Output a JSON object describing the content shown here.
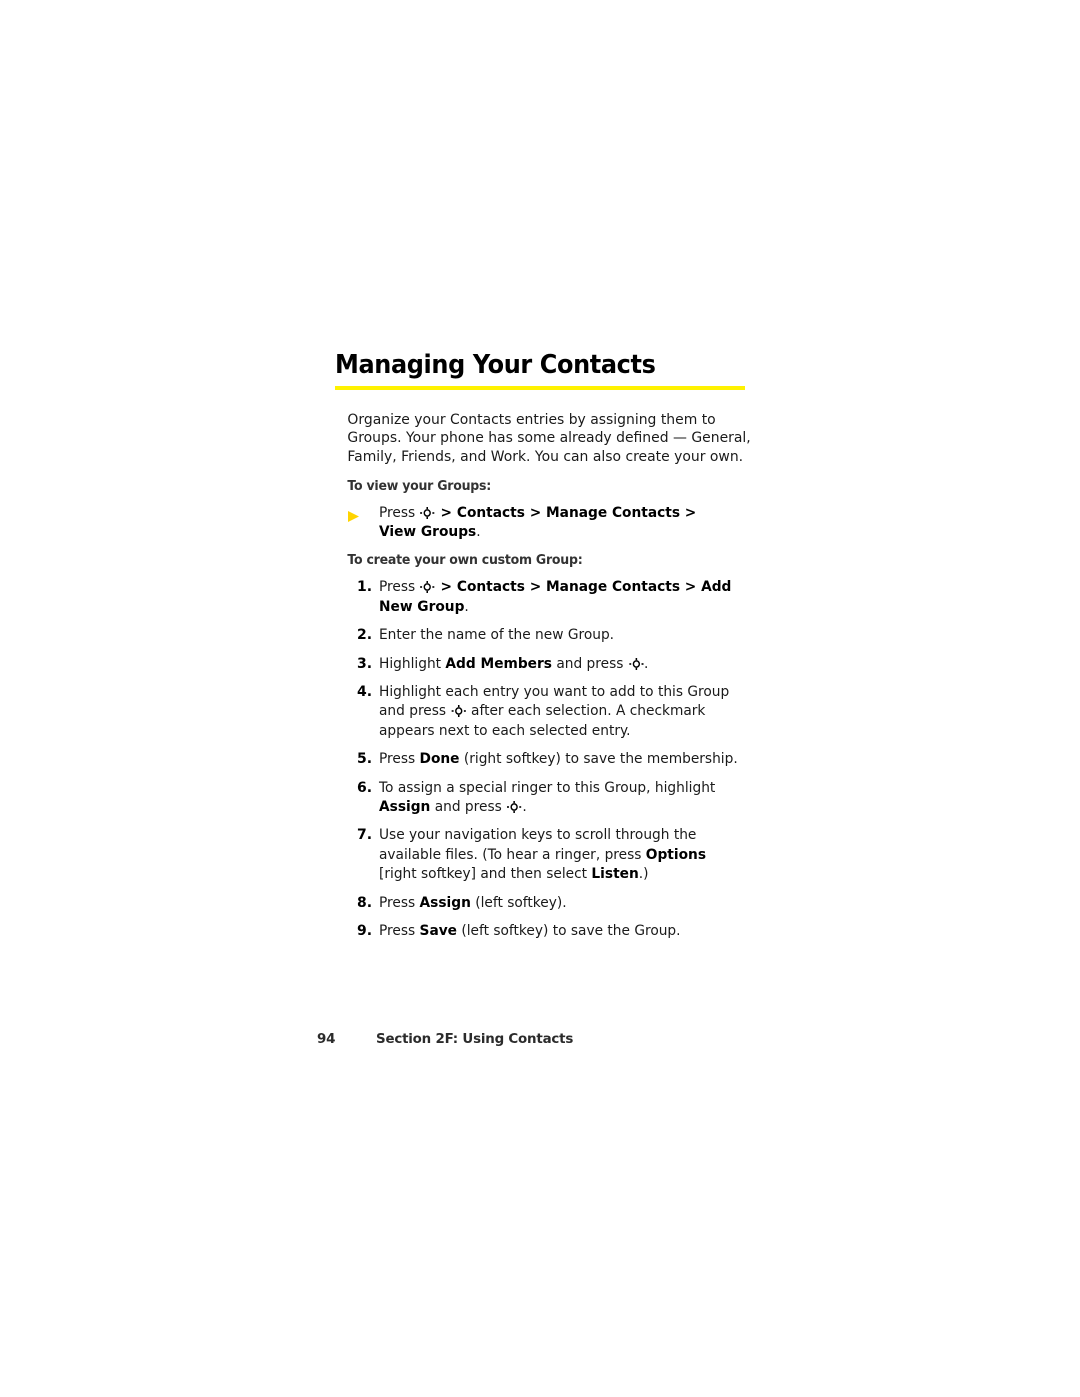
{
  "document": {
    "title": "Managing Your Contacts",
    "accent_color": "#fff200",
    "bullet_color": "#ffd400",
    "intro": "Organize your Contacts entries by assigning them to Groups. Your phone has some already defined — General, Family, Friends, and Work. You can also create your own.",
    "icons": {
      "nav_key": "navigation-key-icon",
      "bullet": "triangle-bullet-icon"
    },
    "sections": [
      {
        "heading": "To view your Groups:",
        "bullet_item": {
          "prefix": "Press ",
          "suffix_bold": " > Contacts > Manage Contacts > View Groups",
          "end": "."
        }
      },
      {
        "heading": "To create your own custom Group:"
      }
    ],
    "steps": [
      {
        "num": "1.",
        "parts": [
          {
            "t": "Press ",
            "b": false
          },
          {
            "t": "__NAVKEY__",
            "b": false
          },
          {
            "t": " > Contacts > Manage Contacts > Add New Group",
            "b": true
          },
          {
            "t": ".",
            "b": false
          }
        ]
      },
      {
        "num": "2.",
        "parts": [
          {
            "t": "Enter the name of the new Group.",
            "b": false
          }
        ]
      },
      {
        "num": "3.",
        "parts": [
          {
            "t": "Highlight ",
            "b": false
          },
          {
            "t": "Add Members",
            "b": true
          },
          {
            "t": " and press ",
            "b": false
          },
          {
            "t": "__NAVKEY__",
            "b": false
          },
          {
            "t": ".",
            "b": false
          }
        ]
      },
      {
        "num": "4.",
        "parts": [
          {
            "t": "Highlight each entry you want to add to this Group and press ",
            "b": false
          },
          {
            "t": "__NAVKEY__",
            "b": false
          },
          {
            "t": " after each selection. A checkmark appears next to each selected entry.",
            "b": false
          }
        ]
      },
      {
        "num": "5.",
        "parts": [
          {
            "t": "Press ",
            "b": false
          },
          {
            "t": "Done",
            "b": true
          },
          {
            "t": " (right softkey) to save the membership.",
            "b": false
          }
        ]
      },
      {
        "num": "6.",
        "parts": [
          {
            "t": "To assign a special ringer to this Group, highlight ",
            "b": false
          },
          {
            "t": "Assign",
            "b": true
          },
          {
            "t": " and press ",
            "b": false
          },
          {
            "t": "__NAVKEY__",
            "b": false
          },
          {
            "t": ".",
            "b": false
          }
        ]
      },
      {
        "num": "7.",
        "parts": [
          {
            "t": "Use your navigation keys to scroll through the available files. (To hear a ringer, press ",
            "b": false
          },
          {
            "t": "Options",
            "b": true
          },
          {
            "t": " [right softkey] and then select ",
            "b": false
          },
          {
            "t": "Listen",
            "b": true
          },
          {
            "t": ".)",
            "b": false
          }
        ]
      },
      {
        "num": "8.",
        "parts": [
          {
            "t": "Press ",
            "b": false
          },
          {
            "t": "Assign",
            "b": true
          },
          {
            "t": " (left softkey).",
            "b": false
          }
        ]
      },
      {
        "num": "9.",
        "parts": [
          {
            "t": "Press ",
            "b": false
          },
          {
            "t": "Save",
            "b": true
          },
          {
            "t": " (left softkey) to save the Group.",
            "b": false
          }
        ]
      }
    ],
    "footer": {
      "page_number": "94",
      "section_label": "Section 2F: Using Contacts"
    }
  }
}
